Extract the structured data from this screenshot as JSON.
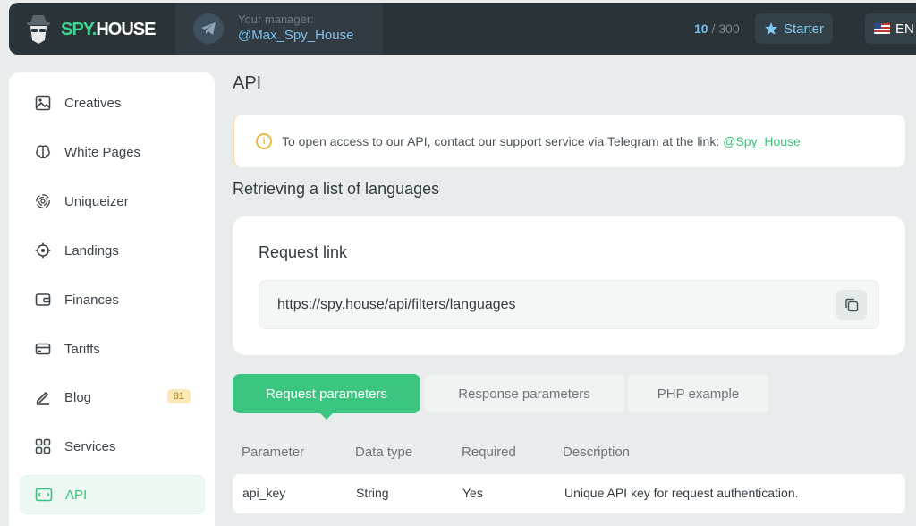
{
  "header": {
    "logo": {
      "spy": "SPY.",
      "house": "HOUSE"
    },
    "manager_label": "Your manager:",
    "manager_name": "@Max_Spy_House",
    "counter_current": "10",
    "counter_sep": " / ",
    "counter_total": "300",
    "plan_label": "Starter",
    "language": "EN"
  },
  "sidebar": {
    "items": [
      {
        "label": "Creatives",
        "icon": "image-icon"
      },
      {
        "label": "White Pages",
        "icon": "brain-icon"
      },
      {
        "label": "Uniqueizer",
        "icon": "fingerprint-icon"
      },
      {
        "label": "Landings",
        "icon": "target-icon"
      },
      {
        "label": "Finances",
        "icon": "wallet-icon"
      },
      {
        "label": "Tariffs",
        "icon": "card-icon"
      },
      {
        "label": "Blog",
        "icon": "pen-icon",
        "badge": "81"
      },
      {
        "label": "Services",
        "icon": "grid-icon"
      },
      {
        "label": "API",
        "icon": "api-icon",
        "active": true
      }
    ]
  },
  "main": {
    "title": "API",
    "notice_text": "To open access to our API, contact our support service via Telegram at the link:",
    "notice_link": "@Spy_House",
    "section_title": "Retrieving a list of languages",
    "card_title": "Request link",
    "request_url": "https://spy.house/api/filters/languages",
    "tabs": [
      {
        "label": "Request parameters",
        "active": true
      },
      {
        "label": "Response parameters"
      },
      {
        "label": "PHP example"
      }
    ],
    "table": {
      "headers": [
        "Parameter",
        "Data type",
        "Required",
        "Description"
      ],
      "rows": [
        [
          "api_key",
          "String",
          "Yes",
          "Unique API key for request authentication."
        ]
      ]
    }
  },
  "colors": {
    "accent": "#3cc580",
    "header_bg": "#2a3338",
    "link_blue": "#7ec0ee"
  }
}
